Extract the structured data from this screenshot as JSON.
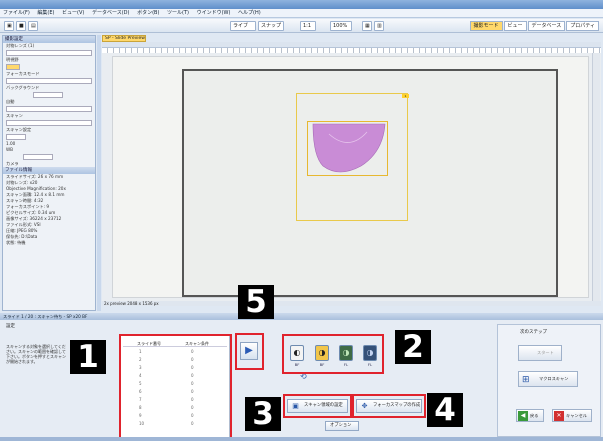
{
  "app": {
    "title": "...",
    "menu": [
      "ファイル(F)",
      "編集(E)",
      "ビュー(V)",
      "データベース(D)",
      "ボタン(B)",
      "ツール(T)",
      "ウインドウ(W)",
      "ヘルプ(H)"
    ],
    "toolbar_buttons": [
      "ライブ",
      "スナップ",
      "1:1",
      "100%"
    ],
    "mode_tabs": [
      "撮影モード",
      "ビュー",
      "データベース",
      "プロパティ"
    ]
  },
  "left_panel": {
    "header": "撮影設定",
    "rows": [
      "対物レンズ (1)",
      "明視野",
      "フォーカスモード",
      "バックグラウンド",
      "自動",
      "スキャン",
      "スキャン設定",
      "1.00",
      "WB",
      "カメラ",
      "ファイル情報"
    ],
    "info_rows": [
      "スライドサイズ: 26 x 76 mm",
      "対物レンズ: x20",
      "Objective Magnification: 20x",
      "スキャン面積: 12.4 x 8.1 mm",
      "スキャン時間: 4:32",
      "フォーカスポイント: 9",
      "ピクセルサイズ: 0.34 um",
      "画像サイズ: 36224 x 23712",
      "ファイル形式: VSI",
      "圧縮: JPEG 80%",
      "保存先: D:\\Data",
      "状態: 待機"
    ]
  },
  "document": {
    "tab": "SP - Slide Preview",
    "status": "2x preview 2048 x 1536 px",
    "flag": "1"
  },
  "bottom": {
    "divider": "スライド 1 / 20 : スキャン待ち - SP x20 BF",
    "label": "設定",
    "instructions": "スキャンする対象を選択してください。スキャンの範囲を確認して下さい。ボタンを押すとスキャンが開始されます。",
    "list_headers": [
      "スライド番号",
      "スキャン条件"
    ],
    "list_rows": [
      [
        "1",
        "0"
      ],
      [
        "2",
        "0"
      ],
      [
        "3",
        "0"
      ],
      [
        "4",
        "0"
      ],
      [
        "5",
        "0"
      ],
      [
        "6",
        "0"
      ],
      [
        "7",
        "0"
      ],
      [
        "8",
        "0"
      ],
      [
        "9",
        "0"
      ],
      [
        "10",
        "0"
      ]
    ],
    "mode_labels": [
      "BF",
      "BF",
      "FL",
      "FL"
    ],
    "scan_settings_button": "スキャン領域の設定",
    "focus_map_button": "フォーカスマップの作成",
    "option_button": "オプション"
  },
  "right_panel": {
    "header": "次のステップ",
    "start_button": "スタート",
    "macro_button": "マクロスキャン",
    "back_button": "戻る",
    "cancel_button": "キャンセル"
  },
  "callouts": [
    "1",
    "2",
    "3",
    "4",
    "5"
  ],
  "colors": {
    "callout_bg": "#000000",
    "highlight": "#e0232d",
    "scan_box": "#e9c94b",
    "tissue": "#c98cd6"
  }
}
